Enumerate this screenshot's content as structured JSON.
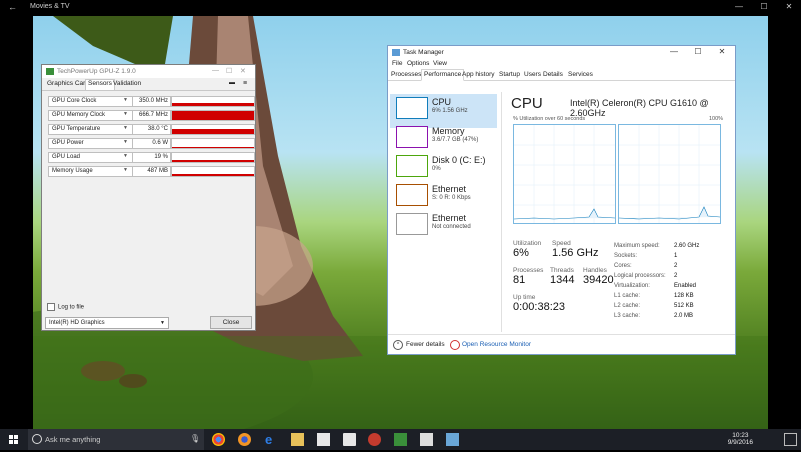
{
  "movies": {
    "title": "Movies & TV",
    "back": "←",
    "min": "—",
    "max": "☐",
    "close": "✕"
  },
  "gpuz": {
    "title": "TechPowerUp GPU-Z 1.9.0",
    "tabs": [
      "Graphics Card",
      "Sensors",
      "Validation"
    ],
    "active_tab": "Sensors",
    "sensors": [
      {
        "name": "GPU Core Clock",
        "value": "350.0 MHz",
        "fill": 0.3,
        "color": "#d00000"
      },
      {
        "name": "GPU Memory Clock",
        "value": "666.7 MHz",
        "fill": 0.95,
        "color": "#d00000"
      },
      {
        "name": "GPU Temperature",
        "value": "38.0 °C",
        "fill": 0.6,
        "color": "#d00000"
      },
      {
        "name": "GPU Power",
        "value": "0.6 W",
        "fill": 0.1,
        "color": "#d00000"
      },
      {
        "name": "GPU Load",
        "value": "19 %",
        "fill": 0.2,
        "color": "#d00000"
      },
      {
        "name": "Memory Usage",
        "value": "487 MB",
        "fill": 0.25,
        "color": "#d00000"
      }
    ],
    "log_label": "Log to file",
    "gpu_select": "Intel(R) HD Graphics",
    "close_label": "Close"
  },
  "taskmanager": {
    "title": "Task Manager",
    "menu": [
      "File",
      "Options",
      "View"
    ],
    "tabs": [
      "Processes",
      "Performance",
      "App history",
      "Startup",
      "Users",
      "Details",
      "Services"
    ],
    "active_tab": "Performance",
    "resources": [
      {
        "name": "CPU",
        "sub": "6% 1.56 GHz",
        "color": "#117dbb"
      },
      {
        "name": "Memory",
        "sub": "3.6/7.7 GB (47%)",
        "color": "#8b12ae"
      },
      {
        "name": "Disk 0 (C: E:)",
        "sub": "0%",
        "color": "#4da60c"
      },
      {
        "name": "Ethernet",
        "sub": "S: 0 R: 0 Kbps",
        "color": "#a74f01"
      },
      {
        "name": "Ethernet",
        "sub": "Not connected",
        "color": "#999999"
      }
    ],
    "cpu": {
      "heading": "CPU",
      "model": "Intel(R) Celeron(R) CPU G1610 @ 2.60GHz",
      "util_label": "% Utilization over 60 seconds",
      "util_max": "100%",
      "utilization_label": "Utilization",
      "utilization": "6%",
      "speed_label": "Speed",
      "speed": "1.56 GHz",
      "processes_label": "Processes",
      "processes": "81",
      "threads_label": "Threads",
      "threads": "1344",
      "handles_label": "Handles",
      "handles": "39420",
      "uptime_label": "Up time",
      "uptime": "0:00:38:23",
      "specs": [
        {
          "k": "Maximum speed:",
          "v": "2.60 GHz"
        },
        {
          "k": "Sockets:",
          "v": "1"
        },
        {
          "k": "Cores:",
          "v": "2"
        },
        {
          "k": "Logical processors:",
          "v": "2"
        },
        {
          "k": "Virtualization:",
          "v": "Enabled"
        },
        {
          "k": "L1 cache:",
          "v": "128 KB"
        },
        {
          "k": "L2 cache:",
          "v": "512 KB"
        },
        {
          "k": "L3 cache:",
          "v": "2.0 MB"
        }
      ]
    },
    "fewer_details": "Fewer details",
    "open_monitor": "Open Resource Monitor"
  },
  "taskbar": {
    "search_placeholder": "Ask me anything",
    "time": "10:23",
    "date": "9/9/2016"
  }
}
